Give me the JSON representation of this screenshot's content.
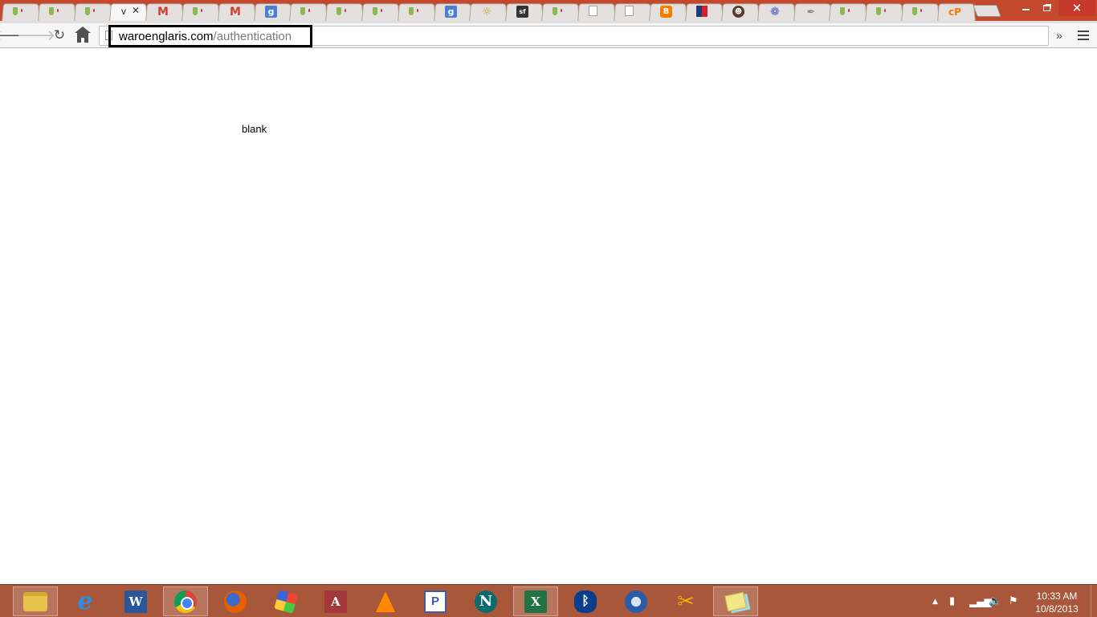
{
  "browser": {
    "tabs": [
      {
        "icon": "leaf-icon"
      },
      {
        "icon": "leaf-icon"
      },
      {
        "icon": "leaf-icon"
      },
      {
        "icon": "none",
        "title": "v",
        "active": true
      },
      {
        "icon": "gmail-icon"
      },
      {
        "icon": "leaf-icon"
      },
      {
        "icon": "gmail-icon"
      },
      {
        "icon": "google-icon"
      },
      {
        "icon": "leaf-icon"
      },
      {
        "icon": "leaf-icon"
      },
      {
        "icon": "leaf-icon"
      },
      {
        "icon": "leaf-icon"
      },
      {
        "icon": "google-icon"
      },
      {
        "icon": "sun-icon"
      },
      {
        "icon": "sourceforge-icon"
      },
      {
        "icon": "leaf-icon"
      },
      {
        "icon": "document-icon"
      },
      {
        "icon": "document-icon"
      },
      {
        "icon": "blogger-icon"
      },
      {
        "icon": "grid-icon"
      },
      {
        "icon": "face-icon"
      },
      {
        "icon": "gear-icon"
      },
      {
        "icon": "feather-icon"
      },
      {
        "icon": "leaf-icon"
      },
      {
        "icon": "leaf-icon"
      },
      {
        "icon": "leaf-icon"
      },
      {
        "icon": "cpanel-icon"
      }
    ],
    "active_tab_title": "v",
    "active_tab_close": "✕",
    "window_close": "✕",
    "url_host": "waroenglaris.com",
    "url_path": "/authentication",
    "overflow": "»"
  },
  "page": {
    "text": "blank"
  },
  "taskbar": {
    "apps": [
      {
        "name": "file-explorer-icon",
        "running": true
      },
      {
        "name": "internet-explorer-icon",
        "running": false,
        "letter": "e"
      },
      {
        "name": "word-icon",
        "running": false,
        "letter": "W"
      },
      {
        "name": "chrome-icon",
        "running": true
      },
      {
        "name": "firefox-icon",
        "running": false
      },
      {
        "name": "windows-flag-icon",
        "running": false
      },
      {
        "name": "access-icon",
        "running": false,
        "letter": "A"
      },
      {
        "name": "vlc-icon",
        "running": false
      },
      {
        "name": "project-icon",
        "running": false,
        "letter": "P"
      },
      {
        "name": "netscape-icon",
        "running": false,
        "letter": "N"
      },
      {
        "name": "excel-icon",
        "running": true,
        "letter": "X"
      },
      {
        "name": "bluetooth-icon",
        "running": false,
        "letter": "ᛒ"
      },
      {
        "name": "thunderbird-icon",
        "running": false
      },
      {
        "name": "keys-icon",
        "running": false,
        "letter": "✂"
      },
      {
        "name": "sticky-notes-icon",
        "running": true
      }
    ],
    "time": "10:33 AM",
    "date": "10/8/2013"
  }
}
